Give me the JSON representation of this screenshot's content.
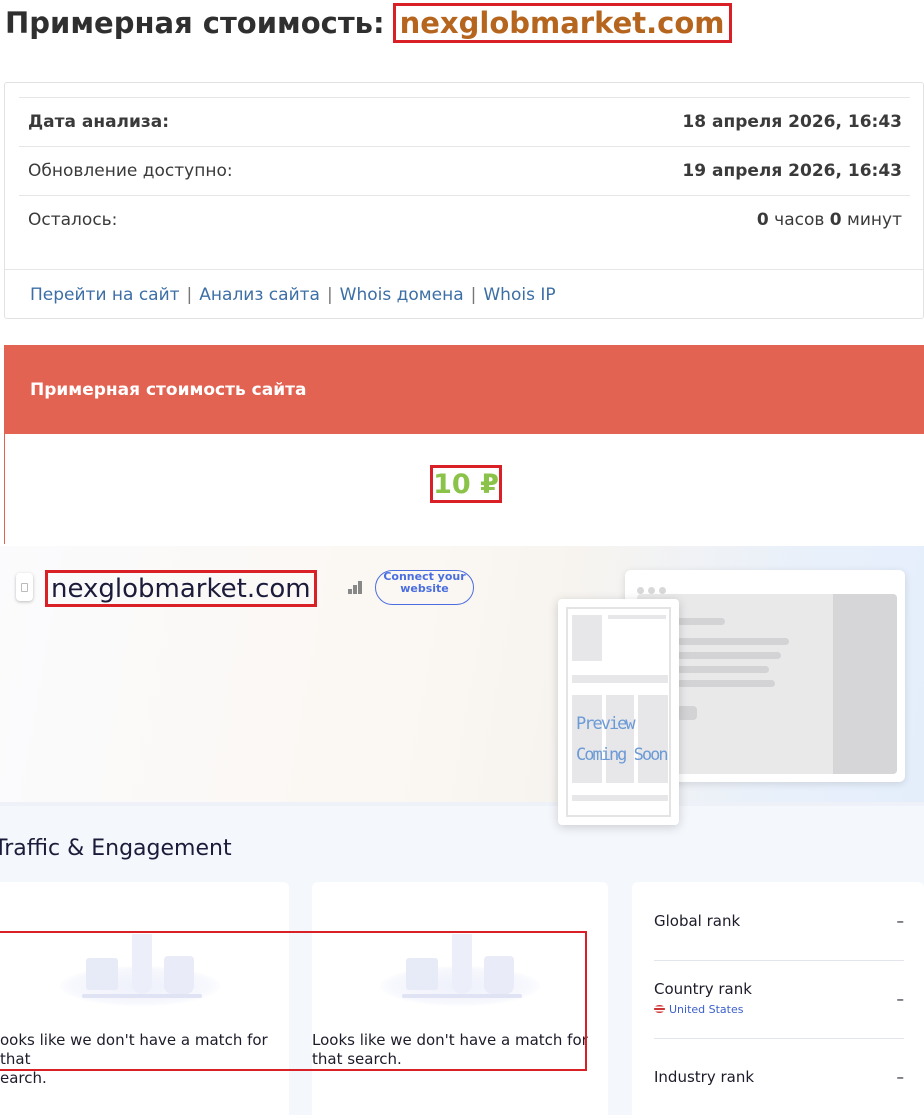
{
  "header": {
    "title_prefix": "Примерная стоимость:",
    "domain": "nexglobmarket.com"
  },
  "info": {
    "rows": [
      {
        "label": "Дата анализа:",
        "value": "18 апреля 2026, 16:43"
      },
      {
        "label": "Обновление доступно:",
        "value": "19 апреля 2026, 16:43"
      },
      {
        "label": "Осталось:",
        "hours": "0",
        "hours_unit": "часов",
        "minutes": "0",
        "minutes_unit": "минут"
      }
    ],
    "links": [
      "Перейти на сайт",
      "Анализ сайта",
      "Whois домена",
      "Whois IP"
    ],
    "separator": "|"
  },
  "value_card": {
    "heading": "Примерная стоимость сайта",
    "price": "10 ₽"
  },
  "similarweb": {
    "domain": "nexglobmarket.com",
    "connect_button": "Connect your website",
    "preview_text": [
      "Preview",
      "Coming Soon"
    ],
    "section_title": "Traffic & Engagement",
    "no_match_text": "Looks like we don't have a match for that search.",
    "no_match_text_left": "ooks like we don't have a match for that",
    "no_match_text_left_2": "earch.",
    "ranks": [
      {
        "label": "Global rank",
        "value": "–"
      },
      {
        "label": "Country rank",
        "value": "–",
        "country": "United States"
      },
      {
        "label": "Industry rank",
        "value": "–"
      }
    ]
  },
  "colors": {
    "accent_red": "#e36352",
    "domain_orange": "#b5651d",
    "price_green": "#8bc34a",
    "link_blue": "#3d6fa6",
    "highlight_border": "#d92027"
  },
  "icons": [
    "document-icon",
    "bars-icon",
    "us-flag-icon"
  ]
}
